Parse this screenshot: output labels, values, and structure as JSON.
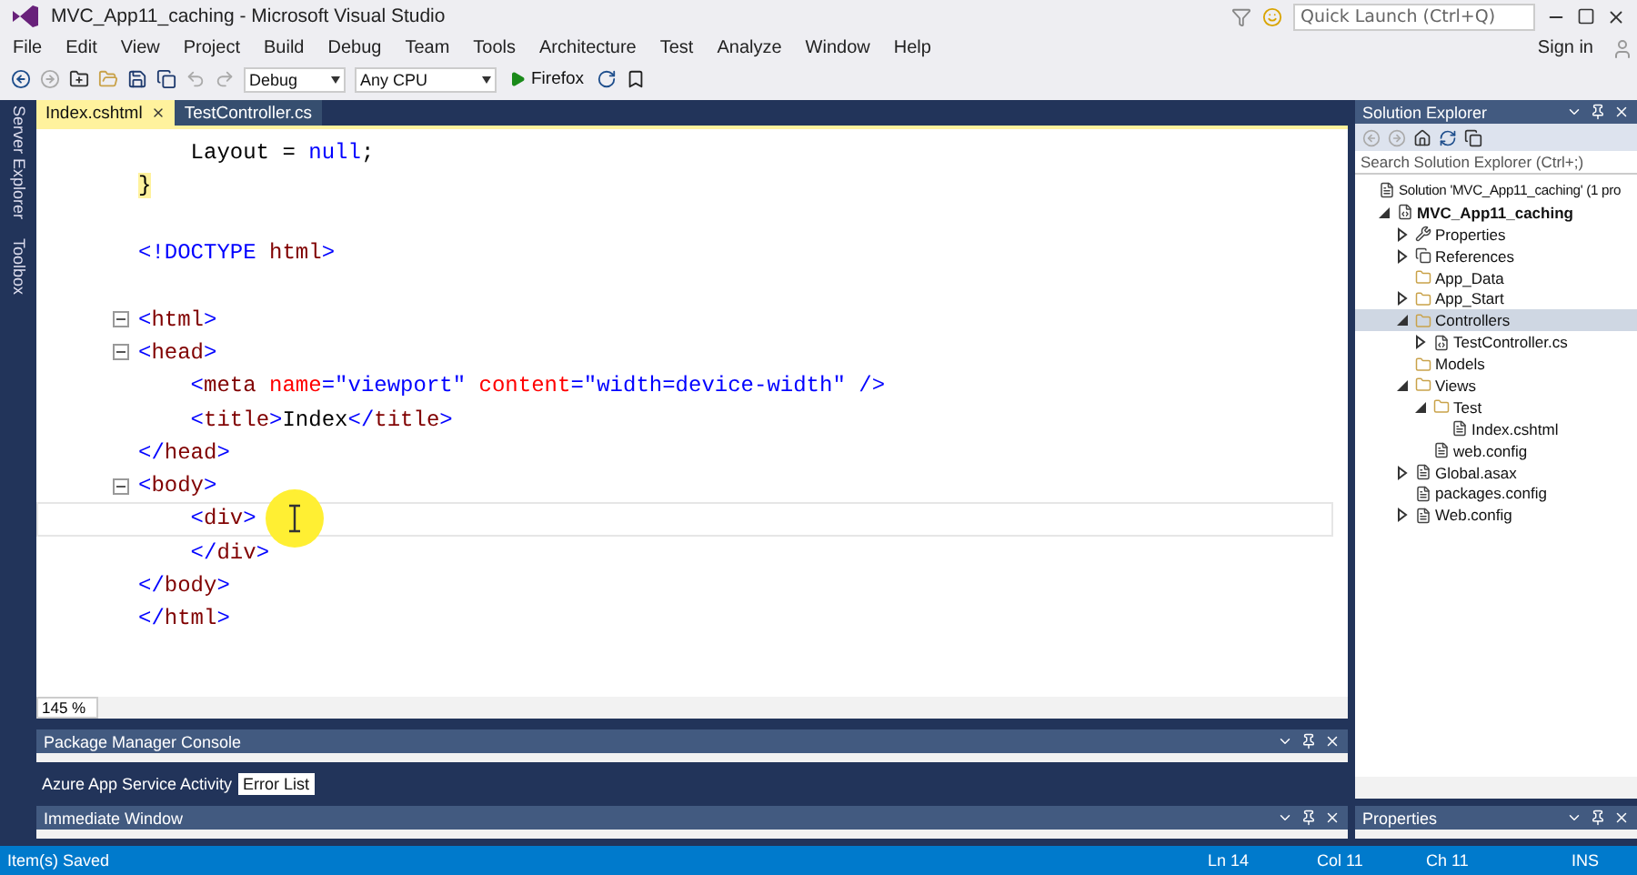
{
  "window": {
    "title": "MVC_App11_caching - Microsoft Visual Studio",
    "quick_launch": {
      "placeholder": "Quick Launch (Ctrl+Q)"
    },
    "sign_in": "Sign in"
  },
  "menu": [
    "File",
    "Edit",
    "View",
    "Project",
    "Build",
    "Debug",
    "Team",
    "Tools",
    "Architecture",
    "Test",
    "Analyze",
    "Window",
    "Help"
  ],
  "toolbar": {
    "configuration": "Debug",
    "platform": "Any CPU",
    "run_target": "Firefox"
  },
  "side_rail": [
    "Server Explorer",
    "Toolbox"
  ],
  "editor_tabs": [
    {
      "label": "Index.cshtml",
      "selected": true
    },
    {
      "label": "TestController.cs",
      "selected": false
    }
  ],
  "code_lines": [
    {
      "fold": false,
      "current": false,
      "tokens": [
        {
          "kind": "text",
          "text": "    Layout = "
        },
        {
          "kind": "keyword",
          "text": "null"
        },
        {
          "kind": "text",
          "text": ";"
        }
      ]
    },
    {
      "fold": false,
      "current": false,
      "tokens": [
        {
          "kind": "brace",
          "text": "}"
        }
      ]
    },
    {
      "fold": false,
      "current": false
    },
    {
      "fold": false,
      "current": false,
      "tokens": [
        {
          "kind": "delim",
          "text": "<!"
        },
        {
          "kind": "delim",
          "text": "DOCTYPE "
        },
        {
          "kind": "tag",
          "text": "html"
        },
        {
          "kind": "delim",
          "text": ">"
        }
      ]
    },
    {
      "fold": false,
      "current": false
    },
    {
      "fold": true,
      "current": false,
      "tokens": [
        {
          "kind": "delim",
          "text": "<"
        },
        {
          "kind": "tag",
          "text": "html"
        },
        {
          "kind": "delim",
          "text": ">"
        }
      ]
    },
    {
      "fold": true,
      "current": false,
      "tokens": [
        {
          "kind": "delim",
          "text": "<"
        },
        {
          "kind": "tag",
          "text": "head"
        },
        {
          "kind": "delim",
          "text": ">"
        }
      ]
    },
    {
      "fold": false,
      "current": false,
      "tokens": [
        {
          "kind": "delim",
          "text": "    <"
        },
        {
          "kind": "tag",
          "text": "meta "
        },
        {
          "kind": "attr",
          "text": "name"
        },
        {
          "kind": "delim",
          "text": "="
        },
        {
          "kind": "value",
          "text": "\"viewport\" "
        },
        {
          "kind": "attr",
          "text": "content"
        },
        {
          "kind": "delim",
          "text": "="
        },
        {
          "kind": "value",
          "text": "\"width=device-width\" "
        },
        {
          "kind": "delim",
          "text": "/>"
        }
      ]
    },
    {
      "fold": false,
      "current": false,
      "tokens": [
        {
          "kind": "delim",
          "text": "    <"
        },
        {
          "kind": "tag",
          "text": "title"
        },
        {
          "kind": "delim",
          "text": ">"
        },
        {
          "kind": "text",
          "text": "Index"
        },
        {
          "kind": "delim",
          "text": "</"
        },
        {
          "kind": "tag",
          "text": "title"
        },
        {
          "kind": "delim",
          "text": ">"
        }
      ]
    },
    {
      "fold": false,
      "current": false,
      "tokens": [
        {
          "kind": "delim",
          "text": "</"
        },
        {
          "kind": "tag",
          "text": "head"
        },
        {
          "kind": "delim",
          "text": ">"
        }
      ]
    },
    {
      "fold": true,
      "current": false,
      "tokens": [
        {
          "kind": "delim",
          "text": "<"
        },
        {
          "kind": "tag",
          "text": "body"
        },
        {
          "kind": "delim",
          "text": ">"
        }
      ]
    },
    {
      "fold": false,
      "current": true,
      "tokens": [
        {
          "kind": "delim",
          "text": "    <"
        },
        {
          "kind": "tag",
          "text": "div"
        },
        {
          "kind": "delim",
          "text": ">"
        }
      ]
    },
    {
      "fold": false,
      "current": false,
      "tokens": [
        {
          "kind": "delim",
          "text": "    </"
        },
        {
          "kind": "tag",
          "text": "div"
        },
        {
          "kind": "delim",
          "text": ">"
        }
      ]
    },
    {
      "fold": false,
      "current": false,
      "tokens": [
        {
          "kind": "delim",
          "text": "</"
        },
        {
          "kind": "tag",
          "text": "body"
        },
        {
          "kind": "delim",
          "text": ">"
        }
      ]
    },
    {
      "fold": false,
      "current": false,
      "tokens": [
        {
          "kind": "delim",
          "text": "</"
        },
        {
          "kind": "tag",
          "text": "html"
        },
        {
          "kind": "delim",
          "text": ">"
        }
      ]
    }
  ],
  "zoom": "145 %",
  "bottom_panels": {
    "package_console": "Package Manager Console",
    "tabs": [
      {
        "label": "Azure App Service Activity",
        "selected": false
      },
      {
        "label": "Error List",
        "selected": true
      }
    ],
    "immediate": "Immediate Window"
  },
  "solution_explorer": {
    "title": "Solution Explorer",
    "search": {
      "placeholder": "Search Solution Explorer (Ctrl+;)"
    },
    "tree": [
      {
        "label": "Solution 'MVC_App11_caching' (1 pro",
        "kind": "solution",
        "selected": false,
        "children": [
          {
            "label": "MVC_App11_caching",
            "kind": "project",
            "expanded": true,
            "selected": false,
            "children": [
              {
                "label": "Properties",
                "kind": "wrench",
                "expanded": false,
                "selected": false
              },
              {
                "label": "References",
                "kind": "references",
                "expanded": false,
                "selected": false
              },
              {
                "label": "App_Data",
                "kind": "folder",
                "selected": false
              },
              {
                "label": "App_Start",
                "kind": "folder",
                "expanded": false,
                "selected": false
              },
              {
                "label": "Controllers",
                "kind": "folder",
                "expanded": true,
                "selected": true,
                "children": [
                  {
                    "label": "TestController.cs",
                    "kind": "csharp",
                    "expanded": false,
                    "selected": false
                  }
                ]
              },
              {
                "label": "Models",
                "kind": "folder",
                "selected": false
              },
              {
                "label": "Views",
                "kind": "folder",
                "expanded": true,
                "selected": false,
                "children": [
                  {
                    "label": "Test",
                    "kind": "folder",
                    "expanded": true,
                    "selected": false,
                    "children": [
                      {
                        "label": "Index.cshtml",
                        "kind": "page",
                        "selected": false
                      }
                    ]
                  },
                  {
                    "label": "web.config",
                    "kind": "config",
                    "selected": false
                  }
                ]
              },
              {
                "label": "Global.asax",
                "kind": "config",
                "expanded": false,
                "selected": false
              },
              {
                "label": "packages.config",
                "kind": "config",
                "selected": false
              },
              {
                "label": "Web.config",
                "kind": "config",
                "expanded": false,
                "selected": false
              }
            ]
          }
        ]
      }
    ]
  },
  "properties": {
    "title": "Properties"
  },
  "status_bar": {
    "message": "Item(s) Saved",
    "line": "Ln 14",
    "column": "Col 11",
    "char": "Ch 11",
    "mode": "INS"
  }
}
